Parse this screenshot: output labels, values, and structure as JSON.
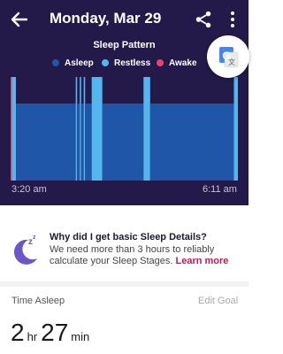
{
  "header": {
    "title": "Monday, Mar 29",
    "back_icon": "arrow-left-icon",
    "share_icon": "share-icon",
    "more_icon": "more-vertical-icon"
  },
  "chart_data": {
    "type": "bar",
    "title": "Sleep Pattern",
    "legend": [
      {
        "name": "Asleep",
        "color": "#1f56a8"
      },
      {
        "name": "Restless",
        "color": "#54b6ee"
      },
      {
        "name": "Awake",
        "color": "#e8436f"
      }
    ],
    "x_labels": [
      "3:20 am",
      "6:11 am"
    ],
    "x_range": [
      "3:20",
      "6:11"
    ],
    "segments": [
      {
        "state": "Awake",
        "start": "3:20",
        "end": "3:21"
      },
      {
        "state": "Restless",
        "start": "3:21",
        "end": "3:24"
      },
      {
        "state": "Asleep",
        "start": "3:24",
        "end": "4:09"
      },
      {
        "state": "Restless",
        "start": "4:09",
        "end": "4:10"
      },
      {
        "state": "Asleep",
        "start": "4:10",
        "end": "4:12"
      },
      {
        "state": "Restless",
        "start": "4:12",
        "end": "4:13"
      },
      {
        "state": "Asleep",
        "start": "4:13",
        "end": "4:15"
      },
      {
        "state": "Restless",
        "start": "4:15",
        "end": "4:16"
      },
      {
        "state": "Asleep",
        "start": "4:16",
        "end": "4:21"
      },
      {
        "state": "Restless",
        "start": "4:21",
        "end": "4:29"
      },
      {
        "state": "Asleep",
        "start": "4:29",
        "end": "5:00"
      },
      {
        "state": "Restless",
        "start": "5:00",
        "end": "5:05"
      },
      {
        "state": "Asleep",
        "start": "5:05",
        "end": "6:08"
      },
      {
        "state": "Restless",
        "start": "6:08",
        "end": "6:11"
      }
    ]
  },
  "translate_button": {
    "icon": "google-translate-icon"
  },
  "sleep_details": {
    "icon": "moon-sleep-icon",
    "title": "Why did I get basic Sleep Details?",
    "body": "We need more than 3 hours to reliably calculate your Sleep Stages.",
    "link": "Learn more"
  },
  "time_asleep": {
    "label": "Time Asleep",
    "edit_label": "Edit Goal",
    "hours": "2",
    "hours_unit": "hr",
    "minutes": "27",
    "minutes_unit": "min"
  }
}
